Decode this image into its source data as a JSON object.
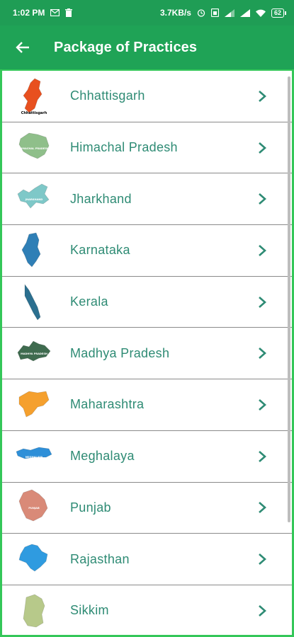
{
  "status_bar": {
    "time": "1:02 PM",
    "speed": "3.7KB/s",
    "battery": "62"
  },
  "header": {
    "title": "Package of Practices",
    "back_icon": "arrow-left-icon"
  },
  "colors": {
    "status_bar": "#1f9d55",
    "app_bar": "#1fa356",
    "item_text": "#2e8b74",
    "chevron": "#2e8b74",
    "list_border": "#34c759"
  },
  "states": [
    {
      "name": "Chhattisgarh",
      "map_color": "#e8501f",
      "map_label": "Chhattisgarh"
    },
    {
      "name": "Himachal Pradesh",
      "map_color": "#8fbf8a",
      "map_label": "HIMACHAL PRADESH"
    },
    {
      "name": "Jharkhand",
      "map_color": "#7ec8c8",
      "map_label": "JHARKHAND"
    },
    {
      "name": "Karnataka",
      "map_color": "#2f7fb6",
      "map_label": ""
    },
    {
      "name": "Kerala",
      "map_color": "#2b6f8f",
      "map_label": ""
    },
    {
      "name": "Madhya Pradesh",
      "map_color": "#3f6b4f",
      "map_label": "MADHYA PRADESH"
    },
    {
      "name": "Maharashtra",
      "map_color": "#f5a02e",
      "map_label": ""
    },
    {
      "name": "Meghalaya",
      "map_color": "#2e8fd8",
      "map_label": "MEGHALAYA"
    },
    {
      "name": "Punjab",
      "map_color": "#d98a78",
      "map_label": "PUNJAB"
    },
    {
      "name": "Rajasthan",
      "map_color": "#2f9be0",
      "map_label": ""
    },
    {
      "name": "Sikkim",
      "map_color": "#b7c98a",
      "map_label": ""
    }
  ]
}
